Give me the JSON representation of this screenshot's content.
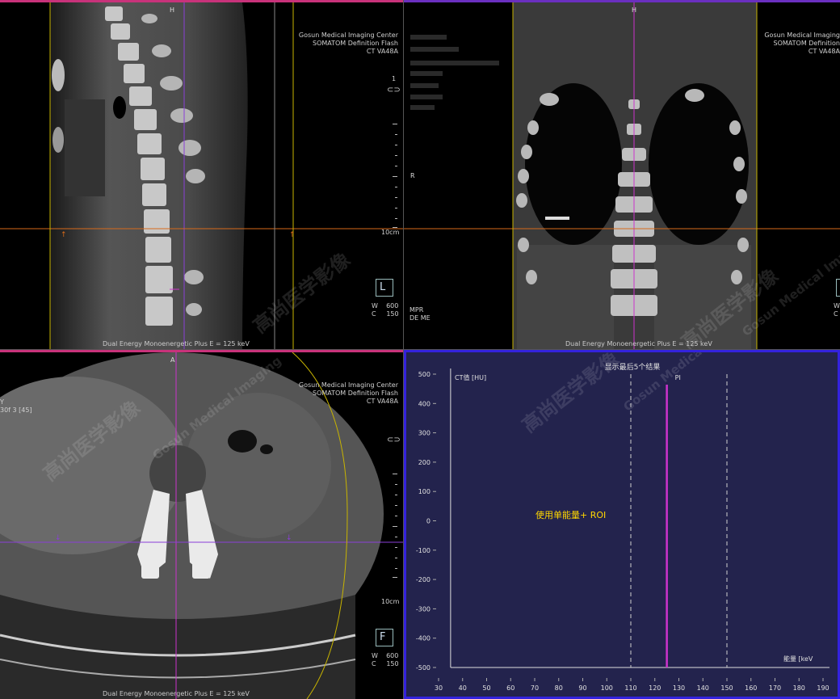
{
  "colors": {
    "sagittal_border": "#c8327a",
    "coronal_border": "#6a2fbf",
    "graph_border": "#3322dd",
    "graph_bg": "#23234d",
    "crosshair_orange": "#d86a1a",
    "crosshair_purple": "#8a3fd8",
    "roi_line": "#cc33cc",
    "annotation_yellow": "#ffd700"
  },
  "watermark": {
    "cn": "高尚医学影像",
    "en": "Gosun Medical Imaging"
  },
  "sagittal": {
    "institution": [
      "Gosun Medical Imaging Center",
      "SOMATOM Definition Flash",
      "CT VA48A"
    ],
    "orientation_top": "H",
    "scale_label": "10cm",
    "index": "1",
    "link_icon": "link-icon",
    "view_icon_letter": "L",
    "window": {
      "w_label": "W",
      "w_value": "600",
      "c_label": "C",
      "c_value": "150"
    },
    "footer": "Dual Energy Monoenergetic Plus E = 125 keV"
  },
  "coronal": {
    "institution": [
      "Gosun Medical Imaging",
      "SOMATOM Definition",
      "CT VA48A"
    ],
    "orientation_top": "H",
    "orientation_left": "R",
    "mode": [
      "MPR",
      "DE ME"
    ],
    "window": {
      "w_label": "W",
      "c_label": "C"
    },
    "footer": "Dual Energy Monoenergetic Plus E = 125 keV"
  },
  "axial": {
    "institution": [
      "Gosun Medical Imaging Center",
      "SOMATOM Definition Flash",
      "CT VA48A"
    ],
    "orientation_top": "A",
    "left_partial": [
      "Y",
      "30f 3 [45]"
    ],
    "scale_label": "10cm",
    "view_icon_letter": "F",
    "window": {
      "w_label": "W",
      "w_value": "600",
      "c_label": "C",
      "c_value": "150"
    },
    "footer": "Dual Energy Monoenergetic Plus E = 125 keV"
  },
  "chart_data": {
    "type": "line",
    "title": "显示最后5个结果",
    "ylabel": "CT值 [HU]",
    "xlabel": "能量 [keV",
    "ylim": [
      -500,
      500
    ],
    "xlim": [
      30,
      190
    ],
    "yticks": [
      500,
      400,
      300,
      200,
      100,
      0,
      -100,
      -200,
      -300,
      -400,
      -500
    ],
    "xticks": [
      30,
      40,
      50,
      60,
      70,
      80,
      90,
      100,
      110,
      120,
      130,
      140,
      150,
      160,
      170,
      180,
      190
    ],
    "reference_lines_dashed_keV": [
      110,
      150
    ],
    "selected_energy_keV": 125,
    "selected_label": "PI",
    "annotation": "使用单能量+ ROI",
    "series": []
  }
}
